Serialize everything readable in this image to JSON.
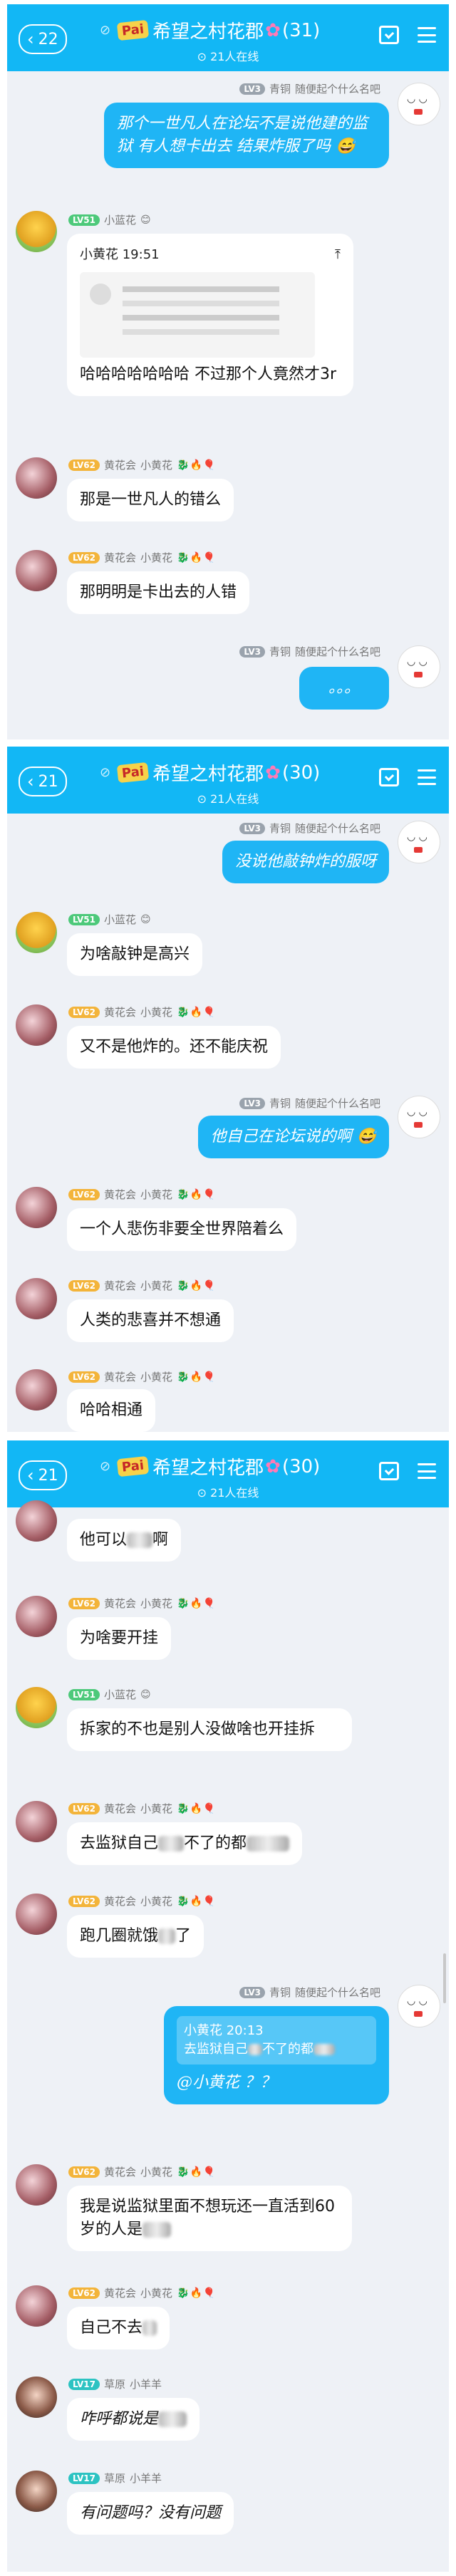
{
  "panels": [
    {
      "back_count": "22",
      "group": "希望之村花郡",
      "count": "(31)",
      "online": "21人在线"
    },
    {
      "back_count": "21",
      "group": "希望之村花郡",
      "count": "(30)",
      "online": "21人在线"
    },
    {
      "back_count": "21",
      "group": "希望之村花郡",
      "count": "(30)",
      "online": "21人在线"
    }
  ],
  "brand": "Pai",
  "users": {
    "self": {
      "level": "LV3",
      "role": "青铜",
      "name": "随便起个什么名吧"
    },
    "xiaolanhua": {
      "level": "LV51",
      "role": "花郡",
      "name": "小蓝花"
    },
    "xiaohuanghua": {
      "level": "LV62",
      "role": "黄花会",
      "name": "小黄花"
    },
    "xiaoyangyang": {
      "level": "LV17",
      "role": "草原",
      "name": "小羊羊"
    }
  },
  "p1": {
    "m1": "那个一世凡人在论坛不是说他建的监狱 有人想卡出去 结果炸服了吗",
    "m2_quote_name": "小黄花 19:51",
    "m2_text": "哈哈哈哈哈哈哈 不过那个人竟然才3r",
    "m3": "那是一世凡人的错么",
    "m4": "那明明是卡出去的人错",
    "m5": "。。。"
  },
  "p2": {
    "m1": "没说他敲钟炸的服呀",
    "m2": "为啥敲钟是高兴",
    "m3": "又不是他炸的。还不能庆祝",
    "m4": "他自己在论坛说的啊",
    "m5": "一个人悲伤非要全世界陪着么",
    "m6": "人类的悲喜并不想通",
    "m7": "哈哈相通"
  },
  "p3": {
    "m1a": "他可以",
    "m1b": "啊",
    "m2": "为啥要开挂",
    "m3": "拆家的不也是别人没做啥也开挂拆",
    "m4a": "去监狱自己",
    "m4b": "不了的都",
    "m5a": "跑几圈就饿",
    "m5b": "了",
    "m6_quote_name": "小黄花 20:13",
    "m6_quote_a": "去监狱自己",
    "m6_quote_b": "不了的都",
    "m6_text": "@小黄花 ？？",
    "m7a": "我是说监狱里面不想玩还一直活到60岁的人是",
    "m8a": "自己不去",
    "m9a": "咋呼都说是",
    "m10": "有问题吗？没有问题"
  }
}
